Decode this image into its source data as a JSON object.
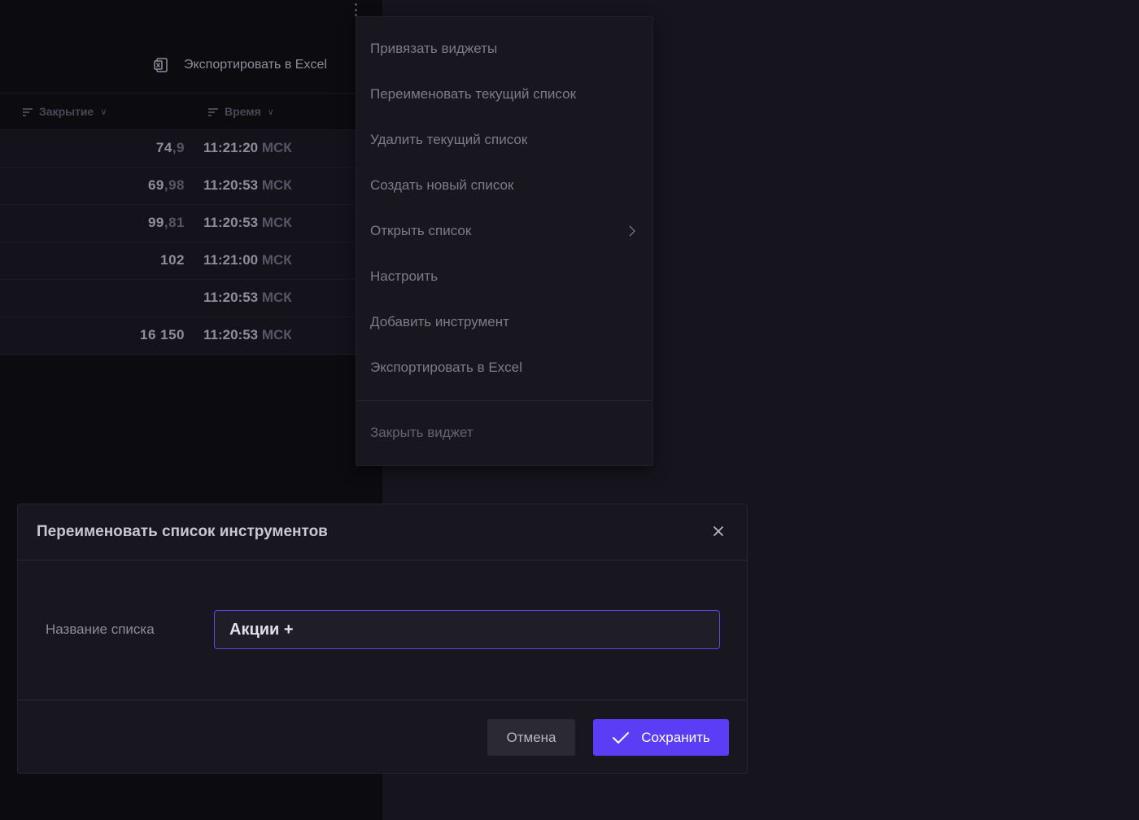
{
  "widget": {
    "export_label": "Экспортировать в Excel",
    "columns": [
      {
        "label": "Закрытие"
      },
      {
        "label": "Время"
      }
    ],
    "rows": [
      {
        "close_int": "74",
        "close_dec": ",9",
        "time": "11:21:20",
        "tz": "МСК"
      },
      {
        "close_int": "69",
        "close_dec": ",98",
        "time": "11:20:53",
        "tz": "МСК"
      },
      {
        "close_int": "99",
        "close_dec": ",81",
        "time": "11:20:53",
        "tz": "МСК"
      },
      {
        "close_int": "102",
        "close_dec": "",
        "time": "11:21:00",
        "tz": "МСК"
      },
      {
        "close_int": "",
        "close_dec": "",
        "time": "11:20:53",
        "tz": "МСК"
      },
      {
        "close_int": "16 150",
        "close_dec": "",
        "time": "11:20:53",
        "tz": "МСК"
      }
    ]
  },
  "context_menu": {
    "items": [
      {
        "label": "Привязать виджеты"
      },
      {
        "label": "Переименовать текущий список"
      },
      {
        "label": "Удалить текущий список"
      },
      {
        "label": "Создать новый список"
      },
      {
        "label": "Открыть список"
      },
      {
        "label": "Настроить"
      },
      {
        "label": "Добавить инструмент"
      },
      {
        "label": "Экспортировать в Excel"
      }
    ],
    "close_widget_label": "Закрыть виджет"
  },
  "dialog": {
    "title": "Переименовать список инструментов",
    "field_label": "Название списка",
    "field_value": "Акции + ",
    "cancel_label": "Отмена",
    "save_label": "Сохранить"
  },
  "colors": {
    "accent": "#5b3df5",
    "input_border": "#5b48e8",
    "background": "#16151d"
  }
}
